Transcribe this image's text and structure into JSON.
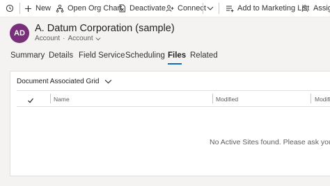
{
  "commands": {
    "new": "New",
    "org_chart": "Open Org Chart",
    "deactivate": "Deactivate",
    "connect": "Connect",
    "marketing": "Add to Marketing List",
    "assign": "Assign"
  },
  "record": {
    "initials": "AD",
    "title": "A. Datum Corporation (sample)",
    "entity": "Account",
    "separator": "·",
    "form": "Account"
  },
  "tabs": [
    "Summary",
    "Details",
    "Field Service",
    "Scheduling",
    "Files",
    "Related"
  ],
  "active_tab": "Files",
  "grid": {
    "view_name": "Document Associated Grid",
    "columns": [
      "Name",
      "Modified",
      "Modifie"
    ],
    "empty_message": "No Active Sites found. Please ask your sy"
  },
  "colors": {
    "avatar": "#7a2f7a",
    "accent": "#0f6cbd"
  }
}
